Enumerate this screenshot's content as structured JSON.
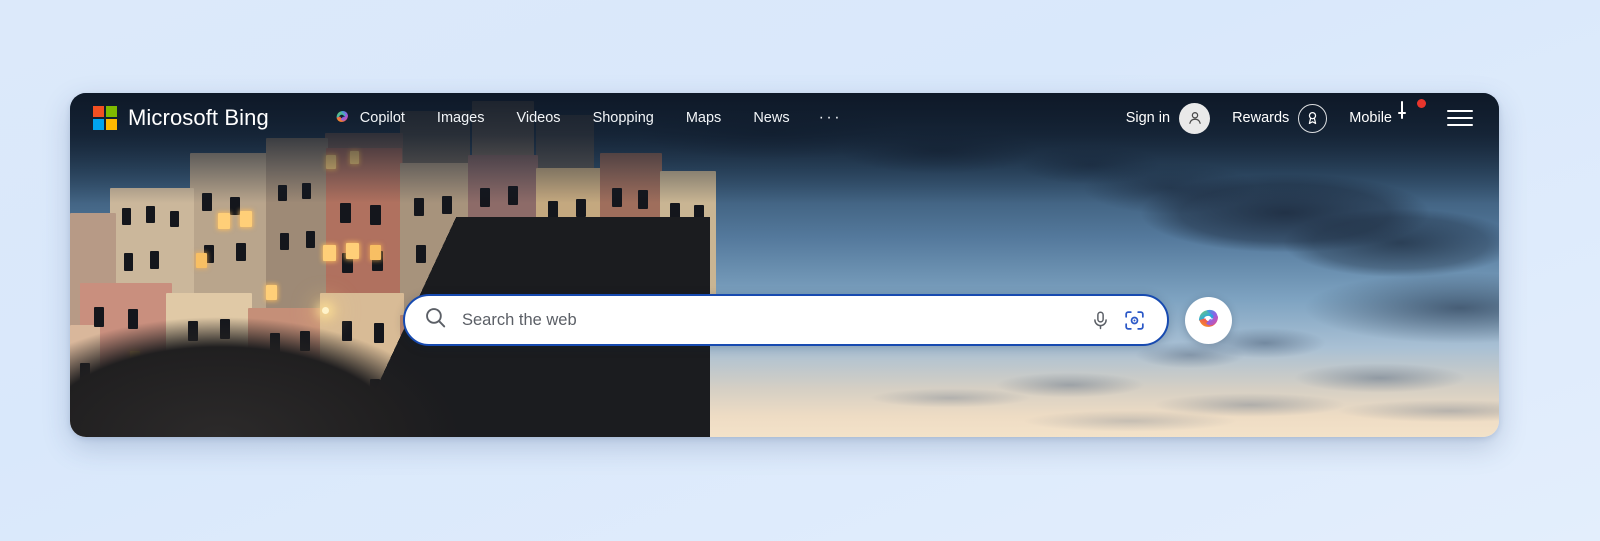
{
  "brand": {
    "name": "Microsoft Bing",
    "logo_icon": "microsoft-squares-icon",
    "colors": {
      "square_top_left": "#f25022",
      "square_top_right": "#7fba00",
      "square_bottom_left": "#00a4ef",
      "square_bottom_right": "#ffb900"
    }
  },
  "nav": {
    "items": [
      {
        "label": "Copilot",
        "icon": "copilot-icon"
      },
      {
        "label": "Images",
        "icon": ""
      },
      {
        "label": "Videos",
        "icon": ""
      },
      {
        "label": "Shopping",
        "icon": ""
      },
      {
        "label": "Maps",
        "icon": ""
      },
      {
        "label": "News",
        "icon": ""
      }
    ],
    "overflow_label": "···",
    "overflow_icon": "ellipsis-icon"
  },
  "account": {
    "sign_in_label": "Sign in",
    "sign_in_icon": "person-avatar-icon",
    "rewards_label": "Rewards",
    "rewards_icon": "medal-icon",
    "mobile_label": "Mobile",
    "mobile_icon": "phone-icon",
    "mobile_badge": true,
    "menu_icon": "hamburger-menu-icon"
  },
  "search": {
    "value": "",
    "placeholder": "Search the web",
    "search_icon": "magnifier-icon",
    "mic_icon": "microphone-icon",
    "camera_icon": "visual-search-camera-icon",
    "copilot_button_icon": "copilot-icon",
    "border_color": "#174ab0",
    "camera_icon_color": "#2b58c7"
  },
  "background": {
    "description": "Cliffside village at dusk with lit windows under a cloudy blue sky",
    "page_color": "#dce9fa"
  }
}
